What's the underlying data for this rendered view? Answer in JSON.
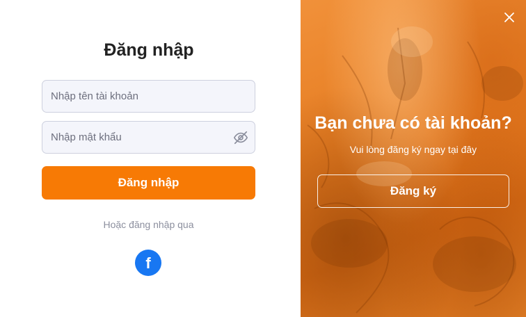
{
  "login": {
    "title": "Đăng nhập",
    "username_placeholder": "Nhập tên tài khoản",
    "username_value": "",
    "password_placeholder": "Nhập mật khẩu",
    "password_value": "",
    "submit_label": "Đăng nhập",
    "social_prompt": "Hoặc đăng nhập qua",
    "facebook_glyph": "f",
    "password_toggle_icon": "eye-off-icon",
    "accent_color": "#f77a05",
    "facebook_color": "#1877f2"
  },
  "signup_panel": {
    "title": "Bạn chưa có tài khoản?",
    "subtitle": "Vui lòng đăng ký ngay tại đây",
    "button_label": "Đăng ký",
    "close_icon": "close-icon",
    "panel_color": "#e8822a"
  }
}
